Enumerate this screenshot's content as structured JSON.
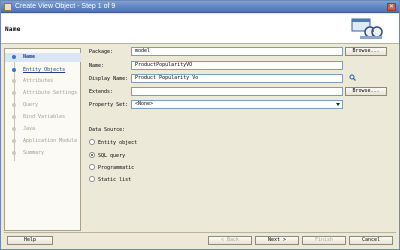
{
  "window": {
    "title": "Create View Object - Step 1 of 9"
  },
  "header": {
    "heading": "Name"
  },
  "sidebar": {
    "items": [
      {
        "label": "Name"
      },
      {
        "label": "Entity Objects"
      },
      {
        "label": "Attributes"
      },
      {
        "label": "Attribute Settings"
      },
      {
        "label": "Query"
      },
      {
        "label": "Bind Variables"
      },
      {
        "label": "Java"
      },
      {
        "label": "Application Module"
      },
      {
        "label": "Summary"
      }
    ]
  },
  "form": {
    "package": {
      "label": "Package:",
      "value": "model",
      "button": "Browse..."
    },
    "name": {
      "label": "Name:",
      "value": "ProductPopularityVO"
    },
    "display_name": {
      "label": "Display Name:",
      "value": "Product Popularity Vo"
    },
    "extends": {
      "label": "Extends:",
      "value": "",
      "button": "Browse..."
    },
    "property_set": {
      "label": "Property Set:",
      "value": "<None>"
    },
    "data_source": {
      "label": "Data Source:",
      "options": [
        {
          "label": "Entity object",
          "selected": false
        },
        {
          "label": "SQL query",
          "selected": true
        },
        {
          "label": "Programmatic",
          "selected": false
        },
        {
          "label": "Static list",
          "selected": false
        }
      ]
    }
  },
  "footer": {
    "help": "Help",
    "back": "< Back",
    "next": "Next >",
    "finish": "Finish",
    "cancel": "Cancel"
  }
}
